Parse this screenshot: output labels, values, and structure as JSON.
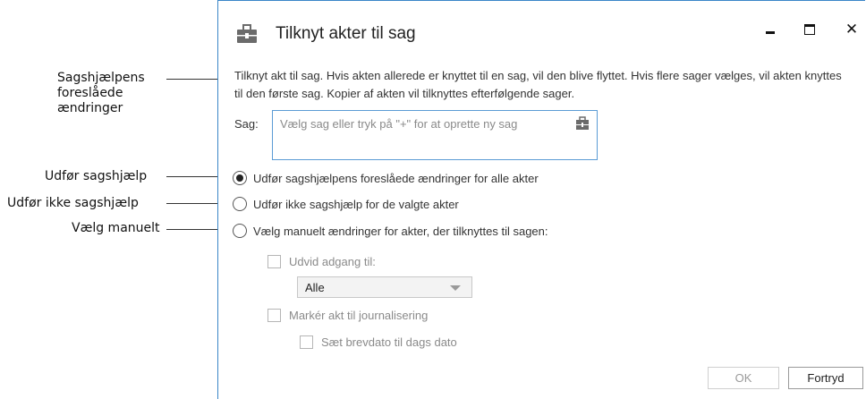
{
  "callouts": {
    "suggested_changes": "Sagshjælpens foreslåede ændringer",
    "apply_help": "Udfør sagshjælp",
    "no_help": "Udfør ikke sagshjælp",
    "manual": "Vælg manuelt"
  },
  "dialog": {
    "title": "Tilknyt akter til sag",
    "close_glyph": "✕",
    "description": "Tilknyt akt til sag. Hvis akten allerede er knyttet til en sag, vil den blive flyttet. Hvis flere sager vælges, vil akten knyttes til den første sag. Kopier af akten vil tilknyttes efterfølgende sager.",
    "sag_label": "Sag:",
    "sag_placeholder": "Vælg sag eller tryk på \"+\" for at oprette ny sag",
    "options": {
      "apply_all": "Udfør sagshjælpens foreslåede ændringer for alle akter",
      "apply_none": "Udfør ikke sagshjælp for de valgte akter",
      "manual": "Vælg manuelt ændringer for akter, der tilknyttes til sagen:"
    },
    "selected_option": "apply_all",
    "expand_access_label": "Udvid adgang til:",
    "access_select_value": "Alle",
    "mark_journal_label": "Markér akt til journalisering",
    "set_date_label": "Sæt brevdato til dags dato",
    "ok_label": "OK",
    "cancel_label": "Fortryd"
  },
  "colors": {
    "accent": "#3a86c8",
    "input_border": "#5b9bd5",
    "icon_body": "#6b6b6b"
  },
  "icons": {
    "app": "briefcase-icon",
    "sag_picker": "case-picker-icon"
  }
}
